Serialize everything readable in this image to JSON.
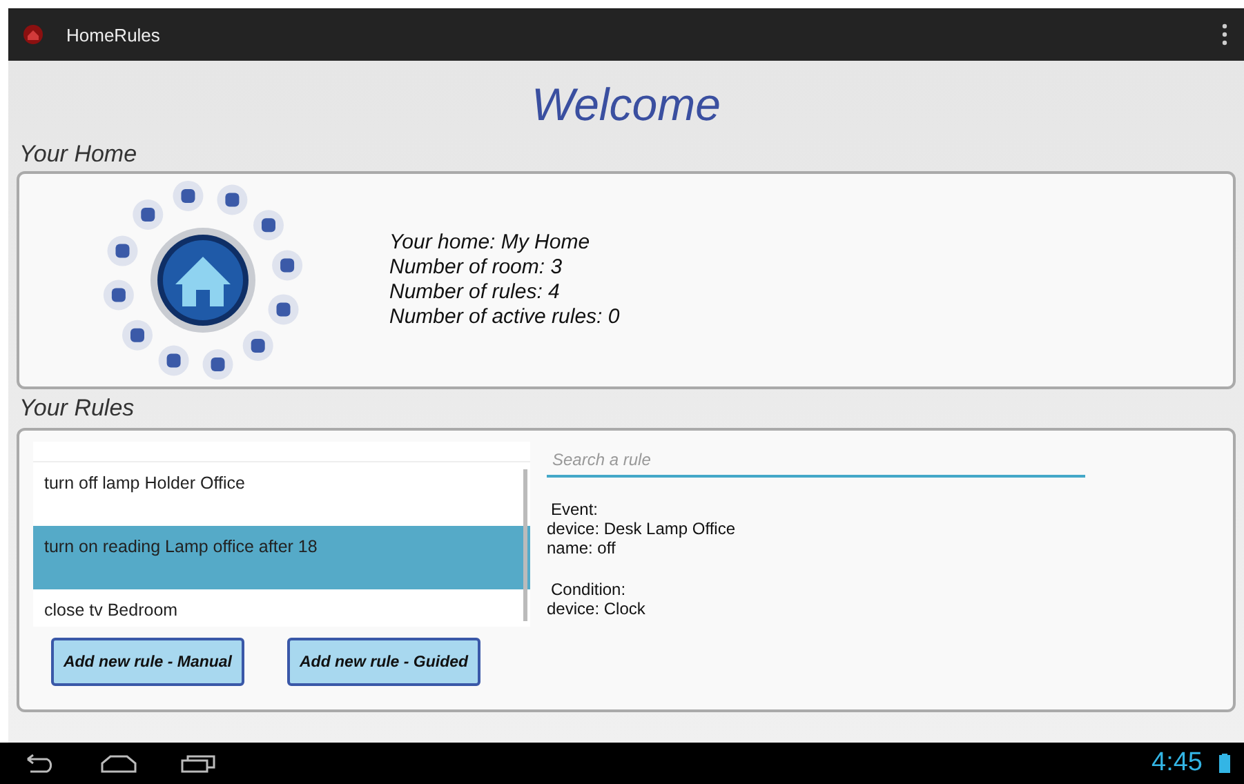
{
  "action_bar": {
    "title": "HomeRules"
  },
  "welcome": "Welcome",
  "home_section": {
    "heading": "Your Home",
    "lines": [
      "Your home: My Home",
      "Number of room: 3",
      "Number of rules: 4",
      "Number of active rules: 0"
    ]
  },
  "rules_section": {
    "heading": "Your Rules",
    "rules": [
      {
        "label": "turn off lamp Holder Office",
        "selected": false
      },
      {
        "label": "turn on reading Lamp office after 18",
        "selected": true
      },
      {
        "label": "close tv Bedroom",
        "selected": false
      }
    ],
    "search": {
      "placeholder": "Search a rule"
    },
    "details": [
      [
        "Event:",
        "device: Desk Lamp Office",
        "name: off"
      ],
      [
        "Condition:",
        "device: Clock"
      ]
    ],
    "buttons": [
      "Add new rule - Manual",
      "Add new rule - Guided"
    ]
  },
  "status_bar": {
    "time": "4:45"
  }
}
